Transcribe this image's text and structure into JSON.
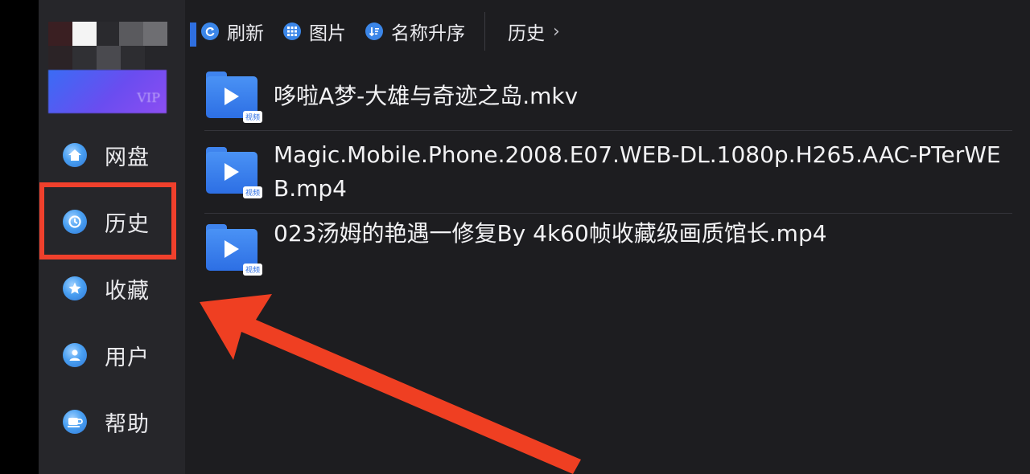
{
  "toolbar": {
    "refresh_label": "刷新",
    "images_label": "图片",
    "sort_label": "名称升序",
    "breadcrumb_label": "历史",
    "breadcrumb_chevron": "›"
  },
  "sidebar": {
    "vip_text": "VIP",
    "items": [
      {
        "label": "网盘",
        "icon": "home-icon"
      },
      {
        "label": "历史",
        "icon": "history-icon"
      },
      {
        "label": "收藏",
        "icon": "star-icon"
      },
      {
        "label": "用户",
        "icon": "user-icon"
      },
      {
        "label": "帮助",
        "icon": "cup-icon"
      }
    ]
  },
  "files": [
    {
      "name": "哆啦A梦-大雄与奇迹之岛.mkv",
      "tag": "视频"
    },
    {
      "name_line1": "Magic.Mobile.Phone.2008.E07.WEB-DL.1080p.H265.AAC-PTerWE",
      "name_line2": "B.mp4",
      "tag": "视频"
    },
    {
      "name": "023汤姆的艳遇一修复By 4k60帧收藏级画质馆长.mp4",
      "tag": "视频"
    }
  ],
  "colors": {
    "accent": "#3b86e8",
    "highlight": "#f0402c",
    "background": "#1d1d20",
    "sidebar": "#26262a"
  }
}
